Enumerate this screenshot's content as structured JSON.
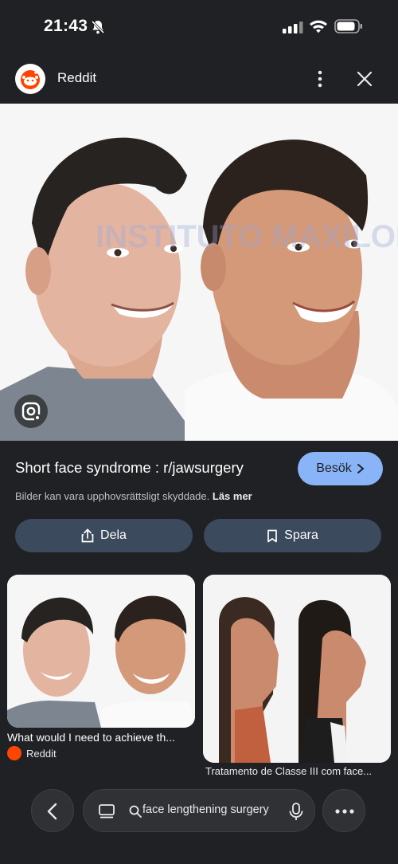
{
  "status": {
    "time": "21:43"
  },
  "header": {
    "site_name": "Reddit"
  },
  "result": {
    "title": "Short face syndrome : r/jawsurgery",
    "visit_label": "Besök",
    "rights_text": "Bilder kan vara upphovsrättsligt skyddade.",
    "rights_link": "Läs mer",
    "share_label": "Dela",
    "save_label": "Spara",
    "watermark": "INSTITUTO MAXILOFACIAL"
  },
  "related": [
    {
      "caption": "What would I need to achieve th...",
      "source": "Reddit"
    },
    {
      "caption": "Tratamento de Classe III com face..."
    }
  ],
  "bottom": {
    "query": "face lengthening surgery"
  },
  "colors": {
    "accent": "#8ab4f8",
    "background": "#202124",
    "pill": "#3c4a5e"
  }
}
